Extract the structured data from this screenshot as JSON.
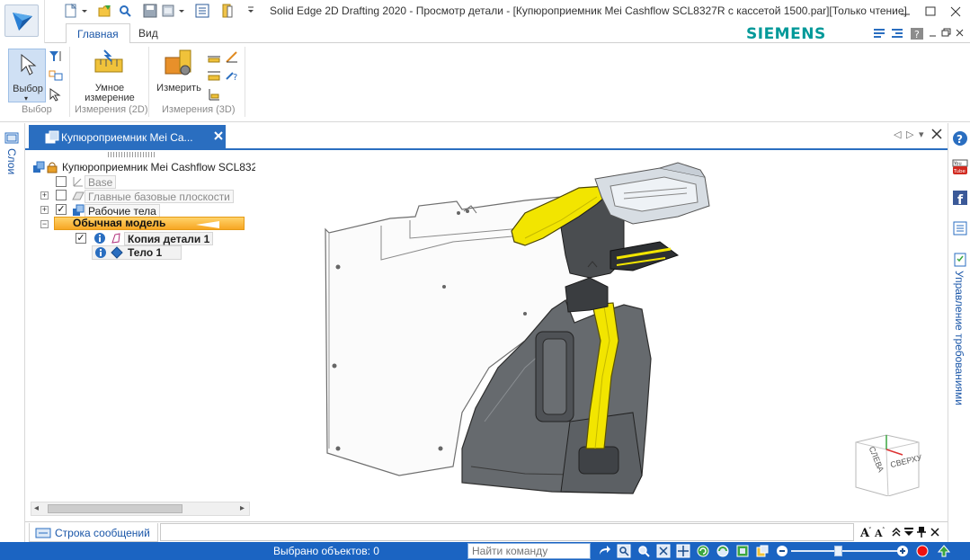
{
  "titlebar": {
    "title": "Solid Edge 2D Drafting 2020 - Просмотр детали - [Купюроприемник Mei Cashflow SCL8327R с кассетой 1500.par][Только чтение]"
  },
  "ribbon": {
    "tabs": [
      {
        "label": "Главная",
        "active": true
      },
      {
        "label": "Вид",
        "active": false
      }
    ],
    "brand": "SIEMENS",
    "groups": {
      "select": {
        "label": "Выбор",
        "button": "Выбор"
      },
      "measure2d": {
        "label": "Измерения (2D)",
        "button_line1": "Умное",
        "button_line2": "измерение"
      },
      "measure3d": {
        "label": "Измерения (3D)",
        "button": "Измерить"
      }
    }
  },
  "left_panel": {
    "label": "Слои"
  },
  "right_panel": {
    "label": "Управление требованиями"
  },
  "document": {
    "tab_label": "Купюроприемник Mei Ca..."
  },
  "tree": {
    "root": "Купюроприемник Mei Cashflow SCL832",
    "items": [
      {
        "label": "Base",
        "checked": false,
        "dimmed": true
      },
      {
        "label": "Главные базовые плоскости",
        "checked": false,
        "dimmed": true
      },
      {
        "label": "Рабочие тела",
        "checked": true,
        "dimmed": false
      },
      {
        "label": "Обычная модель",
        "selected": true
      },
      {
        "label": "Копия детали 1",
        "checked": true
      },
      {
        "label": "Тело 1"
      }
    ]
  },
  "viewcube": {
    "left": "СЛЕВА",
    "top": "СВЕРХУ"
  },
  "message_bar": {
    "tab_label": "Строка сообщений"
  },
  "statusbar": {
    "selection_text": "Выбрано объектов: 0",
    "command_placeholder": "Найти команду",
    "accent": "#1b64c2"
  },
  "colors": {
    "brand": "#009999",
    "accent": "#2a6ec0",
    "highlight": "#f7a623",
    "part_yellow": "#f2e500"
  }
}
